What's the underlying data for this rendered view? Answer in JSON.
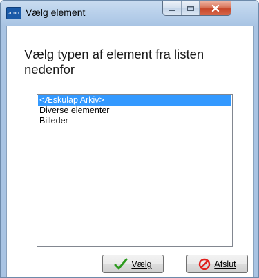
{
  "window": {
    "title": "Vælg element",
    "app_icon_text": "amo"
  },
  "dialog": {
    "heading": "Vælg typen af element fra listen nedenfor",
    "list_items": [
      {
        "label": "<Æskulap Arkiv>",
        "selected": true
      },
      {
        "label": "Diverse elementer",
        "selected": false
      },
      {
        "label": "Billeder",
        "selected": false
      }
    ],
    "ok_button": {
      "label": "Vælg",
      "icon": "checkmark-icon"
    },
    "cancel_button": {
      "label": "Afslut",
      "icon": "no-entry-icon"
    }
  },
  "colors": {
    "selection": "#3399ff",
    "close_button": "#c7472a",
    "checkmark": "#2c9a1e",
    "cancel_icon": "#e0201c"
  }
}
